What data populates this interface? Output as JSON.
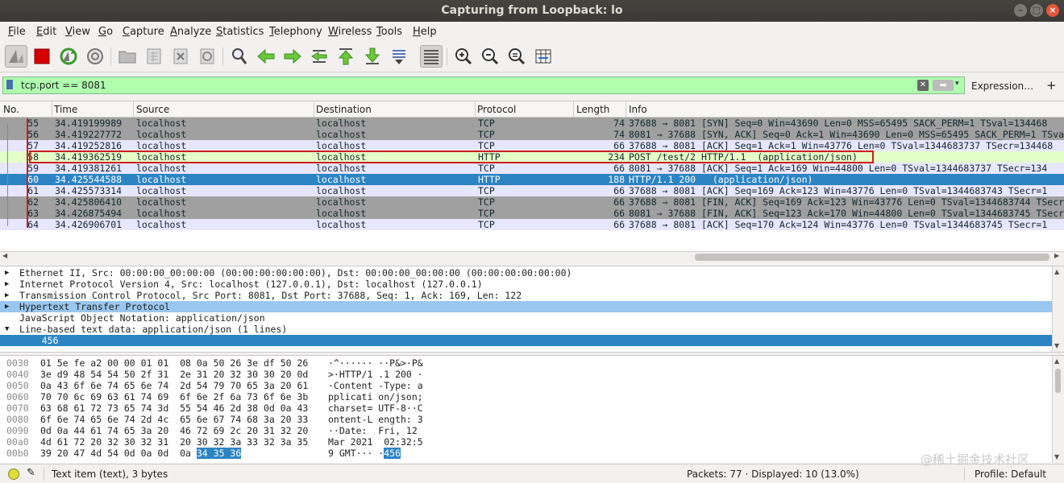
{
  "window": {
    "title": "Capturing from Loopback: lo",
    "btn_min": "–",
    "btn_max": "□",
    "btn_close": "×"
  },
  "menu": [
    "File",
    "Edit",
    "View",
    "Go",
    "Capture",
    "Analyze",
    "Statistics",
    "Telephony",
    "Wireless",
    "Tools",
    "Help"
  ],
  "filter": {
    "value": "tcp.port == 8081",
    "expression_label": "Expression…",
    "plus_label": "+",
    "clear_label": "✕",
    "apply_label": "➡",
    "dropdown_label": "▾"
  },
  "columns": [
    "No.",
    "Time",
    "Source",
    "Destination",
    "Protocol",
    "Length",
    "Info"
  ],
  "packets": [
    {
      "no": "55",
      "time": "34.419199989",
      "src": "localhost",
      "dst": "localhost",
      "proto": "TCP",
      "len": "74",
      "info": "37688 → 8081 [SYN] Seq=0 Win=43690 Len=0 MSS=65495 SACK_PERM=1 TSval=134468",
      "style": "tcp-g"
    },
    {
      "no": "56",
      "time": "34.419227772",
      "src": "localhost",
      "dst": "localhost",
      "proto": "TCP",
      "len": "74",
      "info": "8081 → 37688 [SYN, ACK] Seq=0 Ack=1 Win=43690 Len=0 MSS=65495 SACK_PERM=1 TSval=1",
      "style": "tcp-g"
    },
    {
      "no": "57",
      "time": "34.419252816",
      "src": "localhost",
      "dst": "localhost",
      "proto": "TCP",
      "len": "66",
      "info": "37688 → 8081 [ACK] Seq=1 Ack=1 Win=43776 Len=0 TSval=1344683737 TSecr=134468",
      "style": "tcp-l"
    },
    {
      "no": "58",
      "time": "34.419362519",
      "src": "localhost",
      "dst": "localhost",
      "proto": "HTTP",
      "len": "234",
      "info": "POST /test/2 HTTP/1.1  (application/json)",
      "style": "http"
    },
    {
      "no": "59",
      "time": "34.419381261",
      "src": "localhost",
      "dst": "localhost",
      "proto": "TCP",
      "len": "66",
      "info": "8081 → 37688 [ACK] Seq=1 Ack=169 Win=44800 Len=0 TSval=1344683737 TSecr=134",
      "style": "tcp-l"
    },
    {
      "no": "60",
      "time": "34.425544588",
      "src": "localhost",
      "dst": "localhost",
      "proto": "HTTP",
      "len": "188",
      "info": "HTTP/1.1 200   (application/json)",
      "style": "sel"
    },
    {
      "no": "61",
      "time": "34.425573314",
      "src": "localhost",
      "dst": "localhost",
      "proto": "TCP",
      "len": "66",
      "info": "37688 → 8081 [ACK] Seq=169 Ack=123 Win=43776 Len=0 TSval=1344683743 TSecr=1",
      "style": "tcp-l"
    },
    {
      "no": "62",
      "time": "34.425806410",
      "src": "localhost",
      "dst": "localhost",
      "proto": "TCP",
      "len": "66",
      "info": "37688 → 8081 [FIN, ACK] Seq=169 Ack=123 Win=43776 Len=0 TSval=1344683744 TSecr=1",
      "style": "tcp-g"
    },
    {
      "no": "63",
      "time": "34.426875494",
      "src": "localhost",
      "dst": "localhost",
      "proto": "TCP",
      "len": "66",
      "info": "8081 → 37688 [FIN, ACK] Seq=123 Ack=170 Win=44800 Len=0 TSval=1344683745 TSecr=1",
      "style": "tcp-g"
    },
    {
      "no": "64",
      "time": "34.426906701",
      "src": "localhost",
      "dst": "localhost",
      "proto": "TCP",
      "len": "66",
      "info": "37688 → 8081 [ACK] Seq=170 Ack=124 Win=43776 Len=0 TSval=1344683745 TSecr=1",
      "style": "tcp-l"
    }
  ],
  "details": [
    {
      "arrow": "▶",
      "text": "Ethernet II, Src: 00:00:00_00:00:00 (00:00:00:00:00:00), Dst: 00:00:00_00:00:00 (00:00:00:00:00:00)",
      "style": ""
    },
    {
      "arrow": "▶",
      "text": "Internet Protocol Version 4, Src: localhost (127.0.0.1), Dst: localhost (127.0.0.1)",
      "style": ""
    },
    {
      "arrow": "▶",
      "text": "Transmission Control Protocol, Src Port: 8081, Dst Port: 37688, Seq: 1, Ack: 169, Len: 122",
      "style": ""
    },
    {
      "arrow": "▶",
      "text": "Hypertext Transfer Protocol",
      "style": "hl"
    },
    {
      "arrow": "",
      "text": "JavaScript Object Notation: application/json",
      "style": ""
    },
    {
      "arrow": "▼",
      "text": "Line-based text data: application/json (1 lines)",
      "style": ""
    },
    {
      "arrow": "",
      "text": "    456",
      "style": "sel"
    }
  ],
  "hex": [
    {
      "off": "0030",
      "bytes": "01 5e fe a2 00 00 01 01  08 0a 50 26 3e df 50 26",
      "ascii": "·^······ ··P&>·P&"
    },
    {
      "off": "0040",
      "bytes": "3e d9 48 54 54 50 2f 31  2e 31 20 32 30 30 20 0d",
      "ascii": ">·HTTP/1 .1 200 ·"
    },
    {
      "off": "0050",
      "bytes": "0a 43 6f 6e 74 65 6e 74  2d 54 79 70 65 3a 20 61",
      "ascii": "·Content -Type: a"
    },
    {
      "off": "0060",
      "bytes": "70 70 6c 69 63 61 74 69  6f 6e 2f 6a 73 6f 6e 3b",
      "ascii": "pplicati on/json;"
    },
    {
      "off": "0070",
      "bytes": "63 68 61 72 73 65 74 3d  55 54 46 2d 38 0d 0a 43",
      "ascii": "charset= UTF-8··C"
    },
    {
      "off": "0080",
      "bytes": "6f 6e 74 65 6e 74 2d 4c  65 6e 67 74 68 3a 20 33",
      "ascii": "ontent-L ength: 3"
    },
    {
      "off": "0090",
      "bytes": "0d 0a 44 61 74 65 3a 20  46 72 69 2c 20 31 32 20",
      "ascii": "··Date:  Fri, 12 "
    },
    {
      "off": "00a0",
      "bytes": "4d 61 72 20 32 30 32 31  20 30 32 3a 33 32 3a 35",
      "ascii": "Mar 2021  02:32:5"
    },
    {
      "off": "00b0",
      "bytes": "39 20 47 4d 54 0d 0a 0d  0a ",
      "bytes_sel": "34 35 36",
      "ascii": "9 GMT··· ·",
      "ascii_sel": "456"
    }
  ],
  "status": {
    "item": "Text item (text), 3 bytes",
    "packets": "Packets: 77 · Displayed: 10 (13.0%)",
    "profile": "Profile: Default"
  },
  "watermark": "@稀土掘金技术社区"
}
